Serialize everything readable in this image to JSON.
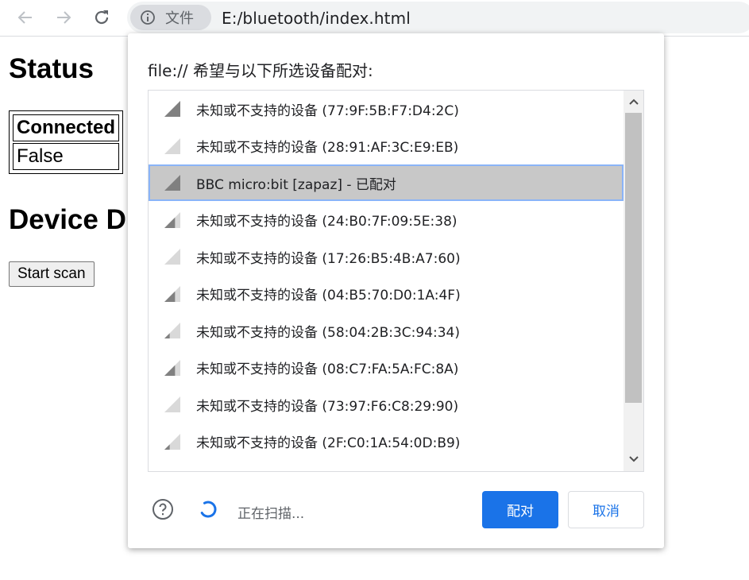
{
  "browser": {
    "chip_label": "文件",
    "url": "E:/bluetooth/index.html"
  },
  "page": {
    "status_heading": "Status",
    "table_header": "Connected",
    "table_value": "False",
    "device_heading": "Device D",
    "scan_button": "Start scan"
  },
  "chooser": {
    "title": "file:// 希望与以下所选设备配对:",
    "devices": [
      {
        "label": "未知或不支持的设备 (77:9F:5B:F7:D4:2C)",
        "signal": 3
      },
      {
        "label": "未知或不支持的设备 (28:91:AF:3C:E9:EB)",
        "signal": 0
      },
      {
        "label": "BBC micro:bit [zapaz] - 已配对",
        "signal": 3,
        "selected": true
      },
      {
        "label": "未知或不支持的设备 (24:B0:7F:09:5E:38)",
        "signal": 2
      },
      {
        "label": "未知或不支持的设备 (17:26:B5:4B:A7:60)",
        "signal": 0
      },
      {
        "label": "未知或不支持的设备 (04:B5:70:D0:1A:4F)",
        "signal": 2
      },
      {
        "label": "未知或不支持的设备 (58:04:2B:3C:94:34)",
        "signal": 1
      },
      {
        "label": "未知或不支持的设备 (08:C7:FA:5A:FC:8A)",
        "signal": 2
      },
      {
        "label": "未知或不支持的设备 (73:97:F6:C8:29:90)",
        "signal": 0
      },
      {
        "label": "未知或不支持的设备 (2F:C0:1A:54:0D:B9)",
        "signal": 1
      }
    ],
    "status_text": "正在扫描...",
    "pair_button": "配对",
    "cancel_button": "取消",
    "colors": {
      "accent": "#1a73e8",
      "selected_bg": "#c8c8c8"
    }
  }
}
